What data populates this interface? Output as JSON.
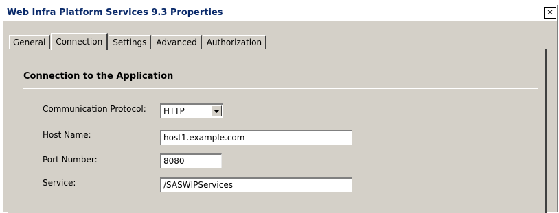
{
  "window": {
    "title": "Web Infra Platform Services 9.3 Properties",
    "close_glyph": "✕"
  },
  "tabs": [
    {
      "label": "General",
      "active": false
    },
    {
      "label": "Connection",
      "active": true
    },
    {
      "label": "Settings",
      "active": false
    },
    {
      "label": "Advanced",
      "active": false
    },
    {
      "label": "Authorization",
      "active": false
    }
  ],
  "section": {
    "title": "Connection to the Application"
  },
  "form": {
    "protocol_label": "Communication Protocol:",
    "protocol_value": "HTTP",
    "host_label": "Host Name:",
    "host_value": "host1.example.com",
    "port_label": "Port Number:",
    "port_value": "8080",
    "service_label": "Service:",
    "service_value": "/SASWIPServices"
  },
  "icons": {
    "close": "close-icon",
    "dropdown": "chevron-down-icon"
  },
  "colors": {
    "dialog_face": "#d4d0c8",
    "title_text": "#0a2a6a"
  }
}
